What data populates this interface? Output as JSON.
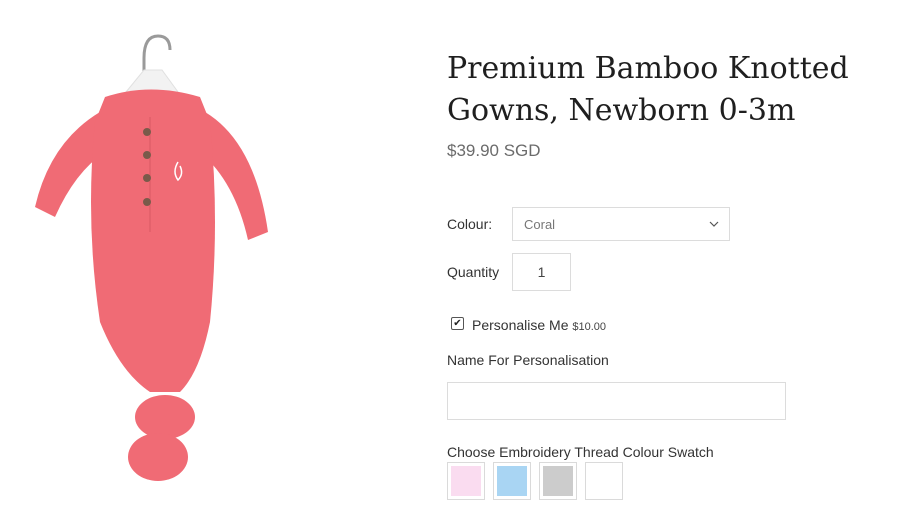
{
  "product": {
    "title": "Premium Bamboo Knotted Gowns, Newborn 0-3m",
    "price": "$39.90 SGD"
  },
  "options": {
    "colour_label": "Colour:",
    "colour_value": "Coral",
    "quantity_label": "Quantity",
    "quantity_value": "1",
    "personalise_label": "Personalise Me",
    "personalise_price": "$10.00",
    "personalise_checked": true,
    "name_label": "Name For Personalisation",
    "name_value": "",
    "swatch_label": "Choose Embroidery Thread Colour Swatch",
    "swatches": [
      "#fadcf0",
      "#a9d5f3",
      "#cccccc",
      "#ffffff"
    ]
  },
  "colors": {
    "gown": "#f06b75",
    "buttons": "#7a5a4a"
  }
}
